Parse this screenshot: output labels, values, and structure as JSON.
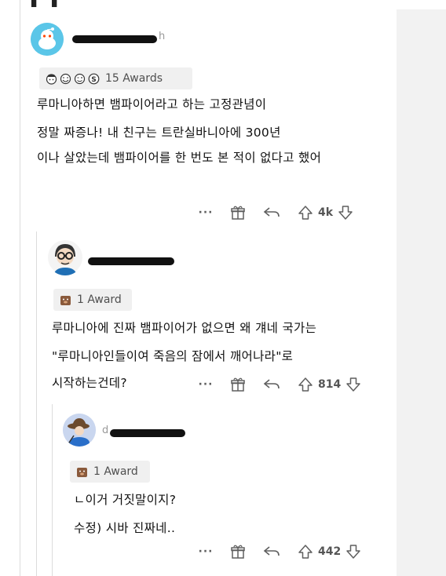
{
  "comments": [
    {
      "username_tail": "h",
      "awards_label": "15 Awards",
      "lines": [
        "루마니아하면 뱀파이어라고 하는 고정관념이",
        "정말 짜증나! 내 친구는 트란실바니아에 300년",
        "이나 살았는데 뱀파이어를 한 번도 본 적이 없다고 했어"
      ],
      "more_label": "···",
      "vote_count": "4k"
    },
    {
      "awards_label": "1 Award",
      "lines": [
        "루마니아에 진짜 뱀파이어가 없으면 왜 걔네 국가는",
        "\"루마니아인들이여 죽음의 잠에서 깨어나라\"로",
        "시작하는건데?"
      ],
      "more_label": "···",
      "vote_count": "814"
    },
    {
      "username_tail": "d",
      "awards_label": "1 Award",
      "lines": [
        "ㄴ이거 거짓말이지?",
        "수정) 시바 진짜네.."
      ],
      "more_label": "···",
      "vote_count": "442"
    }
  ],
  "colors": {
    "accent_avatar": "#5bc6e8",
    "line": "#dcdcdc",
    "text": "#111111",
    "muted": "#5f5f5f"
  },
  "icons": [
    "gift-icon",
    "reply-icon",
    "upvote-icon",
    "downvote-icon",
    "more-icon"
  ]
}
